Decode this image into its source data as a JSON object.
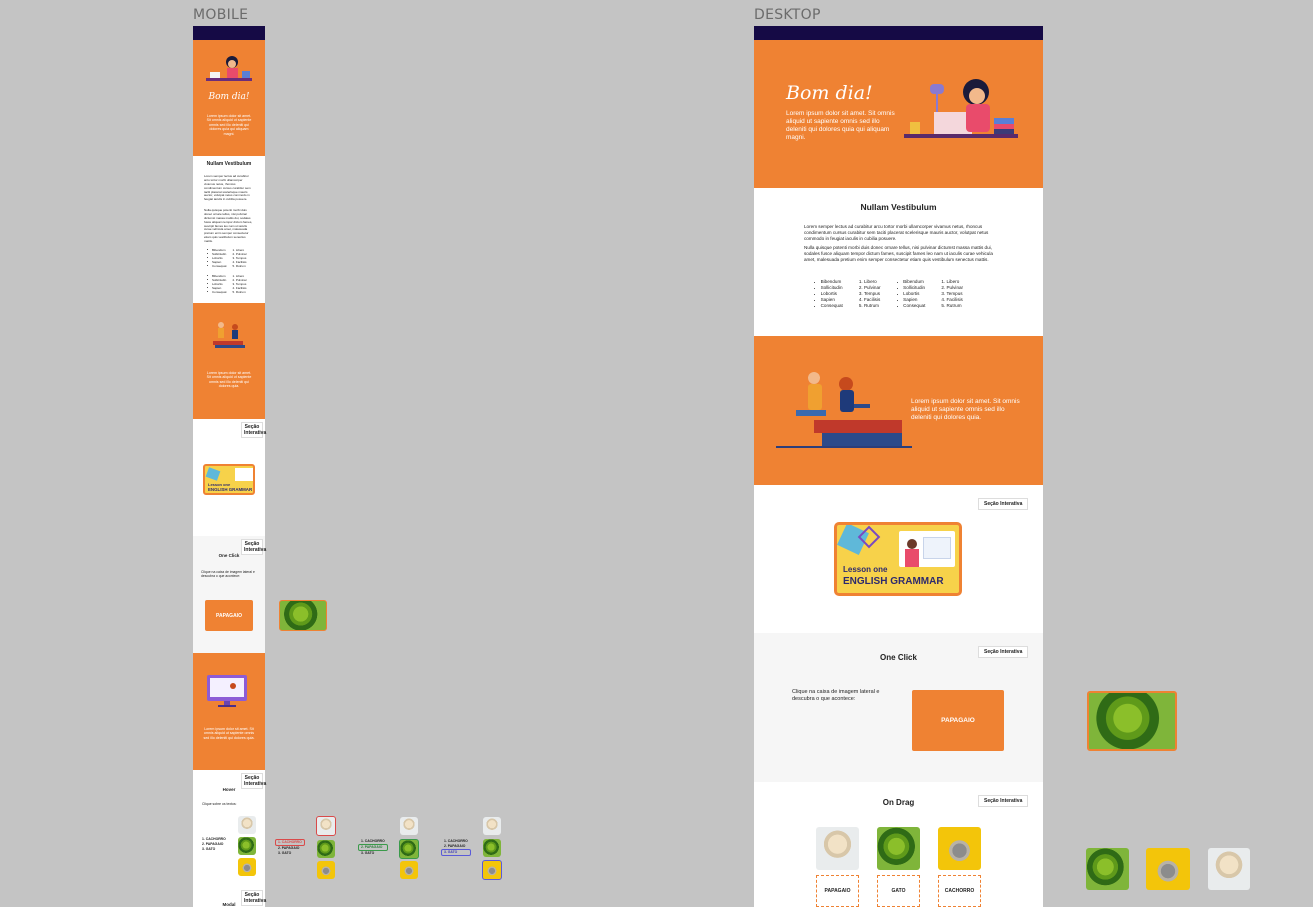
{
  "labels": {
    "mobile": "MOBILE",
    "desktop": "DESKTOP"
  },
  "hero": {
    "greeting": "Bom dia!",
    "text": "Lorem ipsum dolor sit amet. Sit omnis aliquid ut sapiente omnis sed illo deleniti qui dolores quia qui aliquam magni."
  },
  "article": {
    "title": "Nullam Vestibulum",
    "para1": "Lorem semper lectus ad curabitur arcu tortor morbi ullamcorper vivamus netus, rhoncus condimentum cursus curabitur sem taciti placerat scelerisque mauris auctor, volutpat netus commodo in feugiat iaculis in cubilia posuere.",
    "para2": "Nulla quisque potenti morbi duis donec ornare tellus, nisi pulvinar dictumst massa mattis dui, sodales fusce aliquam tempor dictum fames, suscipit fames leo nam ut iaculis curae vehicula amet, malesuada pretium enim semper consectetur etiam quis vestibulum senectus mattis.",
    "bullets": [
      "Bibendum",
      "Sollicitudin",
      "Lobortis",
      "Sapien",
      "Consequat"
    ],
    "numbered": [
      "Libero",
      "Pulvinar",
      "Tempus",
      "Facilisis",
      "Rutrum"
    ]
  },
  "section3": {
    "text": "Lorem ipsum dolor sit amet. Sit omnis aliquid ut sapiente omnis sed illo deleniti qui dolores quia."
  },
  "interactive_tag": "Seção Interativa",
  "lesson": {
    "line1": "Lesson one",
    "line2": "ENGLISH GRAMMAR"
  },
  "oneclick": {
    "title": "One Click",
    "text": "Clique na caixa de imagem lateral e descubra o que acontece:",
    "button": "PAPAGAIO"
  },
  "mobile_section6": {
    "text": "Lorem ipsum dolor sit amet. Sit omnis aliquid ut sapiente omnis sed illo deleniti qui dolores quia."
  },
  "hover": {
    "title": "Hover",
    "text": "Clique sobre os textos:",
    "items": [
      "1. CACHORRO",
      "2. PAPAGAIO",
      "3. GATO"
    ]
  },
  "mobile_last": {
    "title": "Modal"
  },
  "ondrag": {
    "title": "On Drag",
    "targets": [
      "PAPAGAIO",
      "GATO",
      "CACHORRO"
    ]
  },
  "colors": {
    "accent": "#ef8233",
    "navy": "#150a45",
    "canvas": "#c4c4c4"
  }
}
